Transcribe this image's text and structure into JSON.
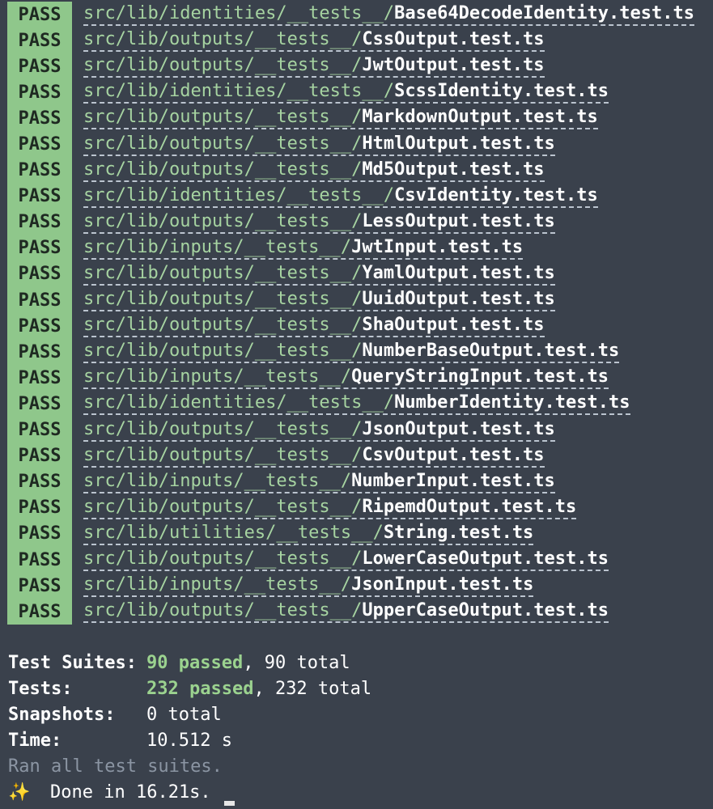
{
  "pass_label": "PASS",
  "tests": [
    {
      "dir": "src/lib/identities/__tests__/",
      "file": "Base64DecodeIdentity.test.ts"
    },
    {
      "dir": "src/lib/outputs/__tests__/",
      "file": "CssOutput.test.ts"
    },
    {
      "dir": "src/lib/outputs/__tests__/",
      "file": "JwtOutput.test.ts"
    },
    {
      "dir": "src/lib/identities/__tests__/",
      "file": "ScssIdentity.test.ts"
    },
    {
      "dir": "src/lib/outputs/__tests__/",
      "file": "MarkdownOutput.test.ts"
    },
    {
      "dir": "src/lib/outputs/__tests__/",
      "file": "HtmlOutput.test.ts"
    },
    {
      "dir": "src/lib/outputs/__tests__/",
      "file": "Md5Output.test.ts"
    },
    {
      "dir": "src/lib/identities/__tests__/",
      "file": "CsvIdentity.test.ts"
    },
    {
      "dir": "src/lib/outputs/__tests__/",
      "file": "LessOutput.test.ts"
    },
    {
      "dir": "src/lib/inputs/__tests__/",
      "file": "JwtInput.test.ts"
    },
    {
      "dir": "src/lib/outputs/__tests__/",
      "file": "YamlOutput.test.ts"
    },
    {
      "dir": "src/lib/outputs/__tests__/",
      "file": "UuidOutput.test.ts"
    },
    {
      "dir": "src/lib/outputs/__tests__/",
      "file": "ShaOutput.test.ts"
    },
    {
      "dir": "src/lib/outputs/__tests__/",
      "file": "NumberBaseOutput.test.ts"
    },
    {
      "dir": "src/lib/inputs/__tests__/",
      "file": "QueryStringInput.test.ts"
    },
    {
      "dir": "src/lib/identities/__tests__/",
      "file": "NumberIdentity.test.ts"
    },
    {
      "dir": "src/lib/outputs/__tests__/",
      "file": "JsonOutput.test.ts"
    },
    {
      "dir": "src/lib/outputs/__tests__/",
      "file": "CsvOutput.test.ts"
    },
    {
      "dir": "src/lib/inputs/__tests__/",
      "file": "NumberInput.test.ts"
    },
    {
      "dir": "src/lib/outputs/__tests__/",
      "file": "RipemdOutput.test.ts"
    },
    {
      "dir": "src/lib/utilities/__tests__/",
      "file": "String.test.ts"
    },
    {
      "dir": "src/lib/outputs/__tests__/",
      "file": "LowerCaseOutput.test.ts"
    },
    {
      "dir": "src/lib/inputs/__tests__/",
      "file": "JsonInput.test.ts"
    },
    {
      "dir": "src/lib/outputs/__tests__/",
      "file": "UpperCaseOutput.test.ts"
    }
  ],
  "summary": {
    "suites": {
      "label": "Test Suites:",
      "passed": "90 passed",
      "total": ", 90 total"
    },
    "tests": {
      "label": "Tests:",
      "passed": "232 passed",
      "total": ", 232 total"
    },
    "snapshots": {
      "label": "Snapshots:",
      "value": "0 total"
    },
    "time": {
      "label": "Time:",
      "value": "10.512 s"
    },
    "ran_all": "Ran all test suites.",
    "done_icon": "sparkles-icon",
    "done_glyph": "✨",
    "done_text": "Done in 16.21s."
  },
  "colors": {
    "background": "#3a414c",
    "pass_badge": "#8fc78b",
    "passed_text": "#9bd28f",
    "dir_text": "#a6d3a1",
    "dim_text": "#8b95a3"
  }
}
